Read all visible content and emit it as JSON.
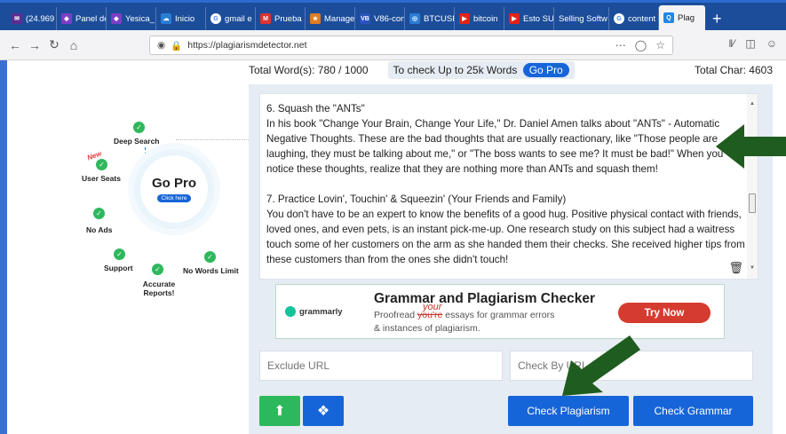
{
  "browser": {
    "tabs": [
      {
        "label": "(24.969",
        "color": "#5b2d91",
        "glyph": "✉"
      },
      {
        "label": "Panel de",
        "color": "#7b3fc4",
        "glyph": "◆"
      },
      {
        "label": "Yesica_",
        "color": "#7b3fc4",
        "glyph": "◆"
      },
      {
        "label": "Inicio",
        "color": "#2a7dd4",
        "glyph": "☁"
      },
      {
        "label": "gmail e",
        "color": "#ffffff",
        "glyph": "G"
      },
      {
        "label": "Prueba",
        "color": "#d33",
        "glyph": "M"
      },
      {
        "label": "Manage",
        "color": "#e07b20",
        "glyph": "★"
      },
      {
        "label": "V86-con",
        "color": "#2a55b8",
        "glyph": "VB"
      },
      {
        "label": "BTCUSD",
        "color": "#2a7dd4",
        "glyph": "◎"
      },
      {
        "label": "bitcoin",
        "color": "#e62117",
        "glyph": "▶"
      },
      {
        "label": "Esto SU",
        "color": "#e62117",
        "glyph": "▶"
      },
      {
        "label": "Selling Softw",
        "color": "",
        "glyph": ""
      },
      {
        "label": "content",
        "color": "#ffffff",
        "glyph": "G"
      },
      {
        "label": "Plag",
        "color": "#1e88e5",
        "glyph": "Q",
        "active": true
      }
    ],
    "url": "https://plagiarismdetector.net"
  },
  "stats": {
    "total_words": "Total Word(s): 780 / 1000",
    "check_up": "To check Up to 25k Words",
    "go_pro": "Go Pro",
    "total_char": "Total Char: 4603"
  },
  "content": {
    "p1_title": "6. Squash the \"ANTs\"",
    "p1_body": "In his book \"Change Your Brain, Change Your Life,\" Dr. Daniel Amen talks about \"ANTs\" - Automatic Negative Thoughts. These are the bad thoughts that are usually reactionary, like \"Those people are laughing, they must be talking about me,\" or \"The boss wants to see me? It must be bad!\" When you notice these thoughts, realize that they are nothing more than ANTs and squash them!",
    "p2_title": "7. Practice Lovin', Touchin' & Squeezin' (Your Friends and Family)",
    "p2_body": "You don't have to be an expert to know the benefits of a good hug. Positive physical contact with friends, loved ones, and even pets, is an instant pick-me-up. One research study on this subject had a waitress touch some of her customers on the arm as she handed them their checks. She received higher tips from these customers than from the ones she didn't touch!"
  },
  "ad": {
    "brand": "grammarly",
    "headline": "Grammar and Plagiarism Checker",
    "sub_pre": "Proofread ",
    "sub_strike": "you're",
    "sub_post": " essays for grammar errors",
    "sub_line2": "& instances of plagiarism.",
    "your": "your",
    "cta": "Try Now"
  },
  "form": {
    "exclude_placeholder": "Exclude URL",
    "checkby_placeholder": "Check By URL",
    "check_plagiarism": "Check Plagiarism",
    "check_grammar": "Check Grammar"
  },
  "promo": {
    "title": "Go Pro",
    "click_here": "Click here",
    "new": "New",
    "features": {
      "deep_search": "Deep Search",
      "user_seats": "User Seats",
      "no_ads": "No Ads",
      "support": "Support",
      "accurate": "Accurate Reports!",
      "no_limit": "No Words Limit"
    }
  },
  "colors": {
    "accent": "#1665d8",
    "upload": "#2eb85c",
    "arrow": "#1f5c1f"
  }
}
